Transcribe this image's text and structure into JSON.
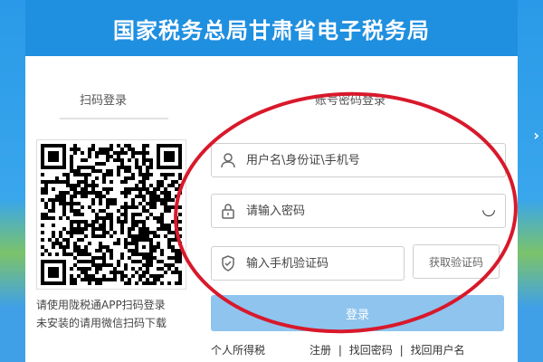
{
  "header": {
    "title": "国家税务总局甘肃省电子税务局"
  },
  "tabs": {
    "qr": "扫码登录",
    "account": "账号密码登录"
  },
  "qr": {
    "note_line1": "请使用陇税通APP扫码登录",
    "note_line2": "未安装的请用微信扫码下载"
  },
  "form": {
    "username_placeholder": "用户名\\身份证\\手机号",
    "password_placeholder": "请输入密码",
    "sms_placeholder": "输入手机验证码",
    "get_code_label": "获取验证码",
    "login_label": "登录"
  },
  "links": {
    "personal_tax": "个人所得税",
    "register": "注册",
    "recover_password": "找回密码",
    "recover_username": "找回用户名",
    "separator": "|"
  },
  "colors": {
    "header_blue": "#1f8fe0",
    "button_blue": "#8ec4ee",
    "annotation_red": "#d8192b"
  }
}
